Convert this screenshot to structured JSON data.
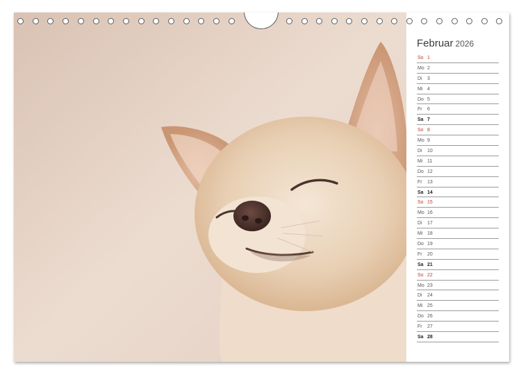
{
  "calendar": {
    "month": "Februar",
    "year": "2026",
    "days": [
      {
        "wd": "So",
        "num": "1",
        "type": "sun"
      },
      {
        "wd": "Mo",
        "num": "2",
        "type": "week"
      },
      {
        "wd": "Di",
        "num": "3",
        "type": "week"
      },
      {
        "wd": "Mi",
        "num": "4",
        "type": "week"
      },
      {
        "wd": "Do",
        "num": "5",
        "type": "week"
      },
      {
        "wd": "Fr",
        "num": "6",
        "type": "week"
      },
      {
        "wd": "Sa",
        "num": "7",
        "type": "sat"
      },
      {
        "wd": "So",
        "num": "8",
        "type": "sun"
      },
      {
        "wd": "Mo",
        "num": "9",
        "type": "week"
      },
      {
        "wd": "Di",
        "num": "10",
        "type": "week"
      },
      {
        "wd": "Mi",
        "num": "11",
        "type": "week"
      },
      {
        "wd": "Do",
        "num": "12",
        "type": "week"
      },
      {
        "wd": "Fr",
        "num": "13",
        "type": "week"
      },
      {
        "wd": "Sa",
        "num": "14",
        "type": "sat"
      },
      {
        "wd": "So",
        "num": "15",
        "type": "sun"
      },
      {
        "wd": "Mo",
        "num": "16",
        "type": "week"
      },
      {
        "wd": "Di",
        "num": "17",
        "type": "week"
      },
      {
        "wd": "Mi",
        "num": "18",
        "type": "week"
      },
      {
        "wd": "Do",
        "num": "19",
        "type": "week"
      },
      {
        "wd": "Fr",
        "num": "20",
        "type": "week"
      },
      {
        "wd": "Sa",
        "num": "21",
        "type": "sat"
      },
      {
        "wd": "So",
        "num": "22",
        "type": "sun"
      },
      {
        "wd": "Mo",
        "num": "23",
        "type": "week"
      },
      {
        "wd": "Di",
        "num": "24",
        "type": "week"
      },
      {
        "wd": "Mi",
        "num": "25",
        "type": "week"
      },
      {
        "wd": "Do",
        "num": "26",
        "type": "week"
      },
      {
        "wd": "Fr",
        "num": "27",
        "type": "week"
      },
      {
        "wd": "Sa",
        "num": "28",
        "type": "sat"
      }
    ]
  },
  "colors": {
    "sunday": "#c0392b",
    "background_tone": "#e9d6c8"
  },
  "photo": {
    "subject": "chihuahua-with-closed-eyes"
  }
}
